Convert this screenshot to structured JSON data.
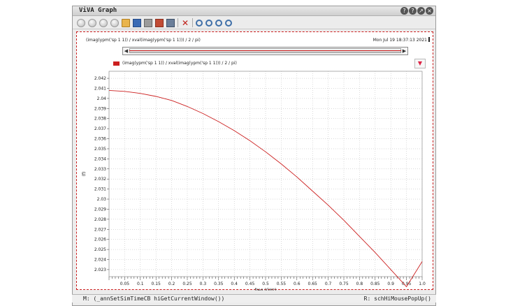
{
  "window": {
    "title": "ViVA Graph"
  },
  "window_buttons": [
    "?",
    "?",
    "↗",
    "×"
  ],
  "toolbar": {
    "icons": [
      "back-icon",
      "forward-icon",
      "up-icon",
      "home-icon",
      "open-folder-icon",
      "save-icon",
      "print-icon",
      "mail-icon",
      "image-icon",
      "delete-icon",
      "zoom-fit-icon",
      "zoom-in-icon",
      "zoom-out-icon",
      "zoom-icon"
    ]
  },
  "graph": {
    "expression": "(imag(ypm('sp 1 1)) / xval(imag(ypm('sp 1 1))) / 2 / pi)",
    "timestamp": "Mon Jul 19 18:37:13 2021",
    "legend_label": "(imag(ypm('sp 1 1)) / xval(imag(ypm('sp 1 1))) / 2 / pi)",
    "filter_icon": "funnel-icon"
  },
  "status_bar": {
    "left": "M: (_annSetSimTimeCB hiGetCurrentWindow())",
    "right": "R: schHiMousePopUp()"
  },
  "colors": {
    "trace": "#cc1f1f",
    "grid": "#b5b5b5",
    "frame": "#cc1f1f"
  },
  "chart_data": {
    "type": "line",
    "xlabel": "freq (GHz)",
    "ylabel": "(f)",
    "xlim": [
      0.0,
      1.0
    ],
    "ylim": [
      2.0223,
      2.0427
    ],
    "xticks": [
      "0.05",
      "0.1",
      "0.15",
      "0.2",
      "0.25",
      "0.3",
      "0.35",
      "0.4",
      "0.45",
      "0.5",
      "0.55",
      "0.6",
      "0.65",
      "0.7",
      "0.75",
      "0.8",
      "0.85",
      "0.9",
      "0.95",
      "1.0"
    ],
    "xtick_values": [
      0.05,
      0.1,
      0.15,
      0.2,
      0.25,
      0.3,
      0.35,
      0.4,
      0.45,
      0.5,
      0.55,
      0.6,
      0.65,
      0.7,
      0.75,
      0.8,
      0.85,
      0.9,
      0.95,
      1.0
    ],
    "yticks": [
      "2.042",
      "2.041",
      "2.04",
      "2.039",
      "2.038",
      "2.037",
      "2.036",
      "2.035",
      "2.034",
      "2.033",
      "2.032",
      "2.031",
      "2.03",
      "2.029",
      "2.028",
      "2.027",
      "2.026",
      "2.025",
      "2.024",
      "2.023"
    ],
    "ytick_values": [
      2.042,
      2.041,
      2.04,
      2.039,
      2.038,
      2.037,
      2.036,
      2.035,
      2.034,
      2.033,
      2.032,
      2.031,
      2.03,
      2.029,
      2.028,
      2.027,
      2.026,
      2.025,
      2.024,
      2.023
    ],
    "grid": true,
    "series": [
      {
        "x": [
          0.0,
          0.05,
          0.1,
          0.15,
          0.2,
          0.25,
          0.3,
          0.35,
          0.4,
          0.45,
          0.5,
          0.55,
          0.6,
          0.65,
          0.7,
          0.75,
          0.8,
          0.85,
          0.9,
          0.95,
          1.0
        ],
        "values": [
          2.0408,
          2.0407,
          2.0405,
          2.0402,
          2.0398,
          2.0392,
          2.0385,
          2.0377,
          2.0368,
          2.0358,
          2.0347,
          2.0335,
          2.0322,
          2.0308,
          2.0294,
          2.0279,
          2.0263,
          2.0247,
          2.023,
          2.0213,
          2.0238
        ]
      }
    ]
  }
}
